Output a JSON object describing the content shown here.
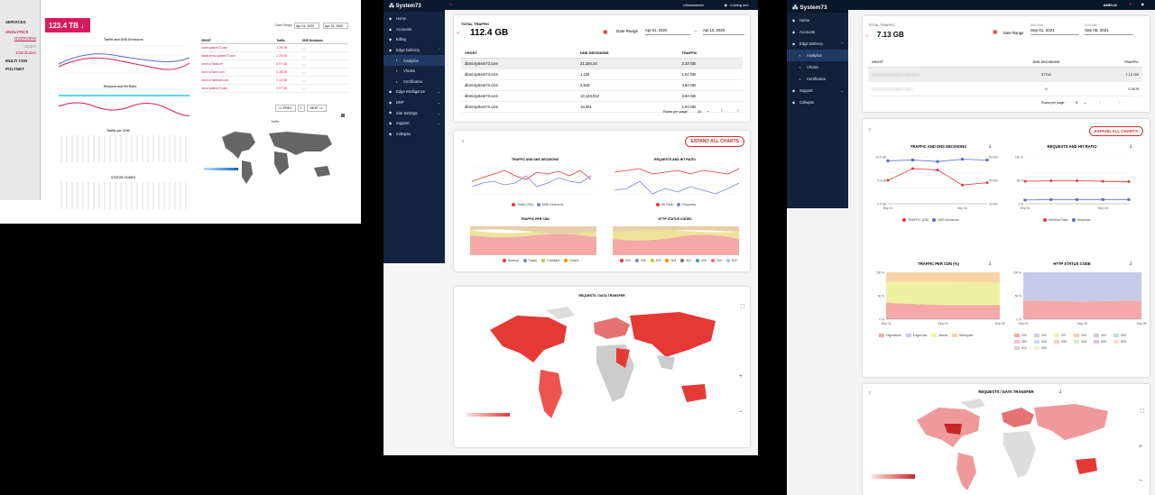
{
  "panel1": {
    "sidebar": [
      "SERVICES",
      "ANALYTICS",
      "OVERVIEW",
      "VIDEO",
      "Distribution",
      "MULTI CDN",
      "POLYNET"
    ],
    "total_label": "123.4 TB",
    "date_range_label": "Date Range",
    "date_from": "Apr 01, 2020",
    "date_to": "Apr 15, 2020",
    "chart_titles": [
      "Traffic and DNS Decisions",
      "Request and Hit Ratio",
      "Traffic per CDN",
      "STATUS CODES"
    ],
    "table_headers": [
      "VHOST",
      "Traffic",
      "DNS Decisions"
    ],
    "table_rows": [
      "clone.system73.com",
      "dlsdjf.demo.system73.com",
      "clone.s73sdk.net",
      "clone.s73cdn.com",
      "clone.s73stream.com",
      "clone.system73.com"
    ],
    "table_values": [
      "2.25 GB",
      "1.20 GB",
      "0.97 GB",
      "0.38 GB",
      "0.12 GB",
      "0.07 GB"
    ],
    "pager": [
      "<< PREV",
      "1",
      "NEXT >>"
    ],
    "map_label": "Traffic"
  },
  "panel2": {
    "logo": "System73",
    "user": "nSeaneeeee",
    "org": "<Listing ao>",
    "nav": [
      {
        "label": "Home",
        "icon": "home-icon",
        "sub": false
      },
      {
        "label": "Accounts",
        "icon": "accounts-icon",
        "sub": false
      },
      {
        "label": "Billing",
        "icon": "billing-icon",
        "sub": false
      },
      {
        "label": "Edge Delivery",
        "icon": "cloud-icon",
        "sub": false,
        "expand": "⌃"
      },
      {
        "label": "Analytics",
        "icon": "analytics-icon",
        "sub": true,
        "active": true
      },
      {
        "label": "Vhosts",
        "icon": "vhosts-icon",
        "sub": true
      },
      {
        "label": "Certificates",
        "icon": "certificate-icon",
        "sub": true
      },
      {
        "label": "Edge Intelligence",
        "icon": "bulb-icon",
        "sub": false,
        "expand": "⌄"
      },
      {
        "label": "DRP",
        "icon": "drp-icon",
        "sub": false,
        "expand": "⌄"
      },
      {
        "label": "Site Settings",
        "icon": "settings-icon",
        "sub": false,
        "expand": "⌄"
      },
      {
        "label": "Support",
        "icon": "support-icon",
        "sub": false,
        "expand": "⌄"
      },
      {
        "label": "Collapse",
        "icon": "chevron-left-icon",
        "sub": false
      }
    ],
    "total_label": "TOTAL TRAFFIC",
    "total_value": "112.4 GB",
    "date_range_label": "Date Range",
    "date_from": "Apr 01, 2020",
    "date_to": "Apr 15, 2020",
    "table_headers": [
      "VHOST",
      "DNS DECISIONS",
      "TRAFFIC"
    ],
    "table_rows": [
      [
        "dlost.system73.com",
        "21,204,34",
        "2.33 GB"
      ],
      [
        "dlost.system73.com",
        "1,234",
        "1.51 GB"
      ],
      [
        "dlost.system73.com",
        "2,543",
        "4.63 GB"
      ],
      [
        "dlost.system73.com",
        "13,123,012",
        "2.94 GB"
      ],
      [
        "dlost.system73.com",
        "13,001",
        "1.03 GB"
      ]
    ],
    "rows_per_page_label": "Rows per page",
    "rows_per_page": "10",
    "expand_all": "EXPAND ALL CHARTS",
    "chart_titles": [
      "TRAFFIC AND DNS DECISIONS",
      "REQUESTS AND HIT RATIO",
      "TRAFFIC PER CDN",
      "HTTP STATUS CODES"
    ],
    "legend_1": [
      "Traffic (GB)",
      "DNS Decisions"
    ],
    "legend_2": [
      "Hit Ratio",
      "Requests"
    ],
    "legend_3": [
      "Akamai",
      "Fastly",
      "Limelight",
      "Level3"
    ],
    "legend_4": [
      "200",
      "206",
      "302",
      "304",
      "400",
      "403",
      "404",
      "500"
    ],
    "map_title": "REQUESTS / DATA TRANSFER"
  },
  "panel3": {
    "logo": "System73",
    "user": "AMELIA",
    "nav": [
      {
        "label": "Home",
        "icon": "home-icon",
        "sub": false
      },
      {
        "label": "Accounts",
        "icon": "accounts-icon",
        "sub": false
      },
      {
        "label": "Edge Delivery",
        "icon": "cloud-icon",
        "sub": false,
        "expand": "⌃"
      },
      {
        "label": "Analytics",
        "icon": "analytics-icon",
        "sub": true,
        "active": true
      },
      {
        "label": "Vhosts",
        "icon": "vhosts-icon",
        "sub": true
      },
      {
        "label": "Certificates",
        "icon": "certificate-icon",
        "sub": true
      },
      {
        "label": "Support",
        "icon": "support-icon",
        "sub": false,
        "expand": "⌄"
      },
      {
        "label": "Collapse",
        "icon": "chevron-left-icon",
        "sub": false
      }
    ],
    "total_label": "TOTAL TRAFFIC",
    "total_value": "7.13 GB",
    "date_range_label": "Date Range",
    "start_label": "Start Date",
    "start_value": "Sep 01, 2021",
    "end_label": "End Date",
    "end_value": "Sep 05, 2021",
    "table_headers": [
      "VHOST",
      "DNS DECISIONS",
      "TRAFFIC"
    ],
    "table_rows": [
      [
        "vhost-blurred-name-system73",
        "37752",
        "7.13 GB"
      ],
      [
        "vhost-blurred-name-other",
        "0",
        "0.00 B"
      ]
    ],
    "rows_per_page_label": "Rows per page",
    "rows_per_page": "5",
    "expand_all": "EXPAND ALL CHARTS",
    "chart_titles": [
      "TRAFFIC AND DNS DECISIONS",
      "REQUESTS AND HIT RATIO",
      "TRAFFIC PER CDN (%)",
      "HTTP STATUS CODE"
    ],
    "axis_1": [
      "10.0 GB",
      "5.0 GB",
      "0.0 GB",
      "60 000",
      "40 000",
      "20 000"
    ],
    "axis_2": [
      "100 %",
      "50 %",
      "0 %"
    ],
    "ylabel_1": "Traffic (GB)",
    "ylabel_1b": "DNS Decisions",
    "ylabel_2": "Hit/Miss Ratio",
    "ylabel_2b": "Requests",
    "xticks_a": [
      "Sep 01",
      "Sep 04"
    ],
    "xticks_b": [
      "Sep 01",
      "Sep 03",
      "Sep 05"
    ],
    "legend_1": [
      "TRAFFIC (GB)",
      "DNS Decisions"
    ],
    "legend_2": [
      "Hit/Miss Ratio",
      "Requests"
    ],
    "legend_3": [
      "HighWinds",
      "EdgeCast",
      "Akmai",
      "Stackpath"
    ],
    "legend_4": [
      "200",
      "204",
      "207",
      "403",
      "404",
      "504",
      "301",
      "400",
      "405",
      "416",
      "500",
      "503",
      "412",
      "505"
    ],
    "map_title": "REQUESTS / DATA TRANSFER"
  },
  "colors": {
    "accent": "#d32f2f",
    "nav_bg": "#13223f",
    "pink": "#d81b60",
    "blue": "#5c6bc0"
  },
  "chart_data": [
    {
      "type": "line",
      "title": "TRAFFIC AND DNS DECISIONS",
      "x": [
        "Sep 01",
        "Sep 02",
        "Sep 03",
        "Sep 04",
        "Sep 05"
      ],
      "series": [
        {
          "name": "TRAFFIC (GB)",
          "values": [
            5.0,
            7.5,
            7.2,
            4.0,
            4.5
          ]
        },
        {
          "name": "DNS Decisions",
          "values": [
            55000,
            56000,
            54000,
            57000,
            56000
          ]
        }
      ]
    },
    {
      "type": "line",
      "title": "REQUESTS AND HIT RATIO",
      "x": [
        "Sep 01",
        "Sep 02",
        "Sep 03",
        "Sep 04",
        "Sep 05"
      ],
      "series": [
        {
          "name": "Hit/Miss Ratio",
          "values": [
            48,
            49,
            49,
            48,
            47
          ]
        },
        {
          "name": "Requests",
          "values": [
            8,
            9,
            9,
            9,
            9
          ]
        }
      ],
      "ylim": [
        0,
        100
      ]
    },
    {
      "type": "area",
      "title": "TRAFFIC PER CDN (%)",
      "x": [
        "Sep 01",
        "Sep 03",
        "Sep 05"
      ],
      "series": [
        {
          "name": "HighWinds",
          "values": [
            35,
            30,
            30
          ]
        },
        {
          "name": "EdgeCast",
          "values": [
            0,
            0,
            0
          ]
        },
        {
          "name": "Akmai",
          "values": [
            45,
            50,
            48
          ]
        },
        {
          "name": "Stackpath",
          "values": [
            20,
            20,
            22
          ]
        }
      ]
    },
    {
      "type": "area",
      "title": "HTTP STATUS CODE",
      "x": [
        "Sep 01",
        "Sep 03",
        "Sep 05"
      ],
      "series": [
        {
          "name": "200",
          "values": [
            40,
            38,
            40
          ]
        },
        {
          "name": "204",
          "values": [
            60,
            62,
            60
          ]
        }
      ]
    }
  ]
}
